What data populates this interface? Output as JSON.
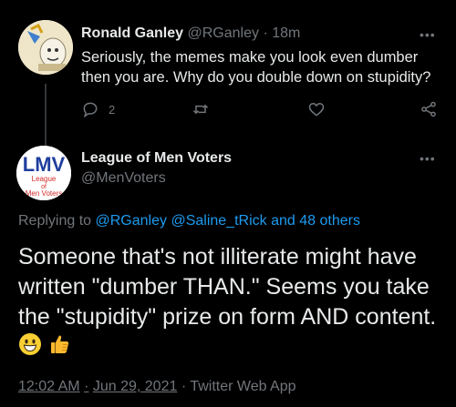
{
  "reply_tweet": {
    "author_name": "Ronald Ganley",
    "author_handle": "@RGanley",
    "separator": "·",
    "time": "18m",
    "body": "Seriously, the memes make you look even dumber then you are. Why do you double down on stupidity?",
    "reply_count": "2",
    "more_label": "•••"
  },
  "main_tweet": {
    "author_name": "League of Men Voters",
    "author_handle": "@MenVoters",
    "avatar_text": {
      "big": "LMV",
      "line1": "League",
      "line2": "of",
      "line3": "Men Voters"
    },
    "more_label": "•••",
    "replying_prefix": "Replying to",
    "replying_users": [
      "@RGanley",
      "@Saline_tRick"
    ],
    "replying_and": "and",
    "replying_others": "48 others",
    "body": "Someone that's not illiterate might have written \"dumber THAN.\"  Seems you take the \"stupidity\" prize on form AND content.",
    "emojis": [
      "grinning-face",
      "thumbs-up"
    ],
    "time": "12:02 AM",
    "date": "Jun 29, 2021",
    "separator": "·",
    "source": "Twitter Web App"
  },
  "colors": {
    "background": "#000000",
    "primary_text": "#e7e9ea",
    "secondary_text": "#71767b",
    "link": "#1d9bf0",
    "lmv_blue": "#1f3f9e",
    "lmv_red": "#d42a2a"
  }
}
